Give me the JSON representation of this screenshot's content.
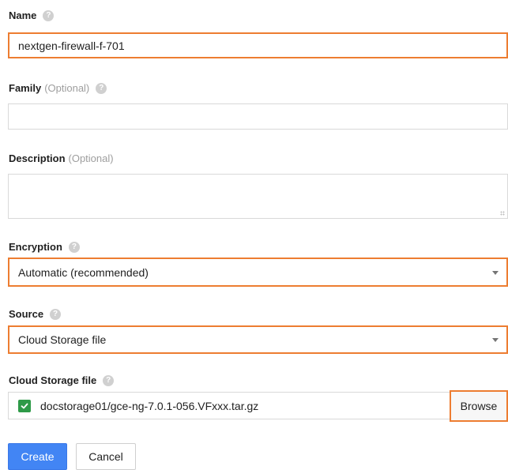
{
  "form": {
    "name": {
      "label": "Name",
      "value": "nextgen-firewall-f-701"
    },
    "family": {
      "label": "Family",
      "optional": "(Optional)",
      "value": ""
    },
    "description": {
      "label": "Description",
      "optional": "(Optional)",
      "value": ""
    },
    "encryption": {
      "label": "Encryption",
      "value": "Automatic (recommended)"
    },
    "source": {
      "label": "Source",
      "value": "Cloud Storage file"
    },
    "cloud_storage_file": {
      "label": "Cloud Storage file",
      "value": "docstorage01/gce-ng-7.0.1-056.VFxxx.tar.gz",
      "browse_label": "Browse"
    }
  },
  "actions": {
    "create_label": "Create",
    "cancel_label": "Cancel"
  },
  "colors": {
    "highlight": "#ed7d31",
    "primary": "#4285f4",
    "success": "#2e9a48"
  }
}
